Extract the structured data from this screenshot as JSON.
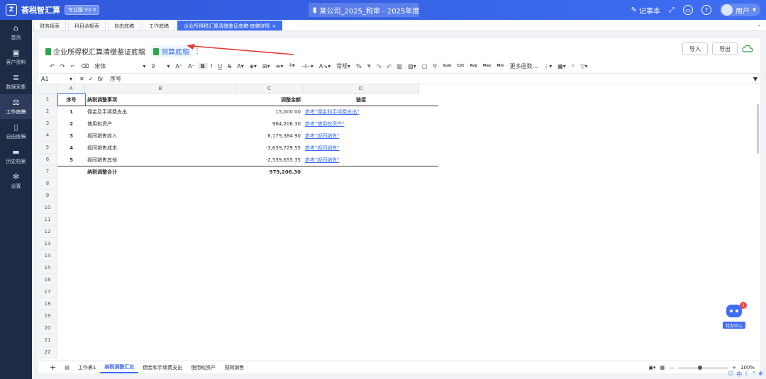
{
  "app": {
    "name": "荟税智汇算",
    "version_badge": "专业版 V2.0",
    "doc_title": "某公司_2025_税审 - 2025年度",
    "notes_label": "记事本",
    "user_name": "用户"
  },
  "sidebar": {
    "items": [
      {
        "label": "首页",
        "icon": "home-icon"
      },
      {
        "label": "客户资料",
        "icon": "id-card-icon"
      },
      {
        "label": "数据采集",
        "icon": "database-icon"
      },
      {
        "label": "工作底稿",
        "icon": "scale-icon"
      },
      {
        "label": "自由底稿",
        "icon": "file-icon"
      },
      {
        "label": "历史档案",
        "icon": "folder-icon"
      },
      {
        "label": "设置",
        "icon": "gear-icon"
      }
    ]
  },
  "tabs": [
    {
      "label": "财务报表"
    },
    {
      "label": "科目余额表"
    },
    {
      "label": "自由底稿"
    },
    {
      "label": "工作底稿"
    },
    {
      "label": "企业所得税汇算清缴鉴证底稿-底稿详情"
    }
  ],
  "page": {
    "title": "企业所得税汇算清缴鉴证底稿",
    "sub_link": "测算底稿",
    "import_label": "导入",
    "export_label": "导出"
  },
  "toolbar": {
    "font": "宋体",
    "size": "9",
    "format": "常规",
    "more_functions": "更多函数...",
    "func_sum": "Sum",
    "func_cnt": "Cnt",
    "func_avg": "Avg",
    "func_max": "Max",
    "func_min": "Min"
  },
  "formula": {
    "cell_ref": "A1",
    "content": "序号"
  },
  "grid": {
    "columns": [
      "A",
      "B",
      "C",
      "D"
    ],
    "row_numbers": [
      "1",
      "2",
      "3",
      "4",
      "5",
      "6",
      "7",
      "8",
      "9",
      "10",
      "11",
      "12",
      "13",
      "14",
      "15",
      "16",
      "17",
      "18",
      "19",
      "20",
      "21",
      "22"
    ],
    "header": {
      "no": "序号",
      "item": "纳税调整事项",
      "amount": "调整金额",
      "link": "链接"
    },
    "rows": [
      {
        "no": "1",
        "item": "佣金及手续费支出",
        "amount": "15,000.00",
        "link": "参考\"佣金和手续费支出\""
      },
      {
        "no": "2",
        "item": "使用权资产",
        "amount": "964,206.30",
        "link": "参考\"使用权资产\""
      },
      {
        "no": "3",
        "item": "视同销售收入",
        "amount": "6,179,384.90",
        "link": "参考\"视同销售\""
      },
      {
        "no": "4",
        "item": "视同销售成本",
        "amount": "-3,639,729.55",
        "link": "参考\"视同销售\""
      },
      {
        "no": "5",
        "item": "视同销售其他",
        "amount": "-2,539,655.35",
        "link": "参考\"视同销售\""
      }
    ],
    "total": {
      "label": "纳税调整合计",
      "amount": "979,206.30"
    }
  },
  "sheet_tabs": [
    {
      "label": "工作表1"
    },
    {
      "label": "纳税调整汇总"
    },
    {
      "label": "佣金和手续费支出"
    },
    {
      "label": "使用权资产"
    },
    {
      "label": "视同销售"
    }
  ],
  "zoom": "100%",
  "assistant": {
    "label": "待办中心",
    "badge": "1"
  },
  "tray": {
    "lang": "中"
  }
}
